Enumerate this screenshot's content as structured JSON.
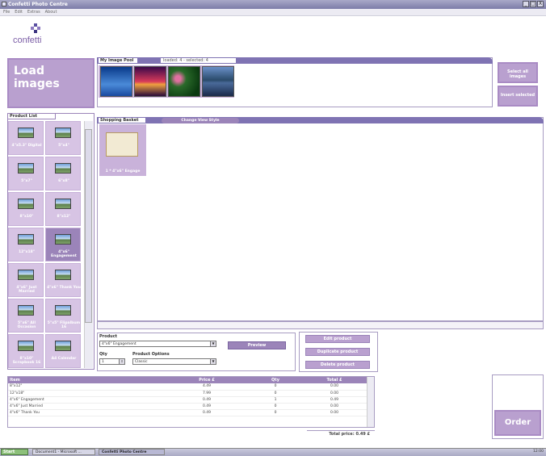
{
  "window": {
    "title": "Confetti Photo Centre",
    "menu": [
      "File",
      "Edit",
      "Extras",
      "About"
    ],
    "controls": [
      "_",
      "□",
      "X"
    ]
  },
  "logo": {
    "text": "confetti"
  },
  "load_images": {
    "label": "Load images"
  },
  "image_pool": {
    "tab": "My Image Pool",
    "status": "loaded: 4 - selected: 4",
    "thumbs": [
      "blue",
      "sunset",
      "flowers",
      "lake"
    ]
  },
  "pool_buttons": {
    "select_all": "Select all images",
    "insert_selected": "Insert selected"
  },
  "product_list": {
    "tab": "Product List",
    "items": [
      {
        "label": "4\"x5.3\" Digital"
      },
      {
        "label": "5\"x4\""
      },
      {
        "label": "5\"x7\""
      },
      {
        "label": "6\"x8\""
      },
      {
        "label": "8\"x10\""
      },
      {
        "label": "8\"x12\""
      },
      {
        "label": "12\"x18\""
      },
      {
        "label": "4\"x6\" Engagement"
      },
      {
        "label": "4\"x6\" Just Married"
      },
      {
        "label": "4\"x6\" Thank You"
      },
      {
        "label": "5\"x6\" All Occasion"
      },
      {
        "label": "5\"x5\" Flipalbum 16"
      },
      {
        "label": "8\"x10\" Scrapbook 16"
      },
      {
        "label": "A4 Calendar"
      }
    ]
  },
  "basket": {
    "tab": "Shopping Basket",
    "change_view": "Change View Style",
    "item_label": "1 * 4\"x6\" Engage"
  },
  "form": {
    "product_label": "Product",
    "product_value": "4\"x6\" Engagement",
    "qty_label": "Qty",
    "qty_value": "1",
    "options_label": "Product Options",
    "options_value": "Classic",
    "preview": "Preview"
  },
  "actions": {
    "edit": "Edit product",
    "duplicate": "Duplicate product",
    "delete": "Delete product"
  },
  "table": {
    "headers": [
      "Item",
      "Price £",
      "Qty",
      "Total £"
    ],
    "rows": [
      {
        "item": "8\"x12\"",
        "price": "4.49",
        "qty": "0",
        "total": "0.00"
      },
      {
        "item": "12\"x18\"",
        "price": "7.99",
        "qty": "0",
        "total": "0.00"
      },
      {
        "item": "4\"x6\" Engagement",
        "price": "0.49",
        "qty": "1",
        "total": "0.49"
      },
      {
        "item": "4\"x6\" Just Married",
        "price": "0.49",
        "qty": "0",
        "total": "0.00"
      },
      {
        "item": "4\"x6\" Thank You",
        "price": "0.49",
        "qty": "0",
        "total": "0.00"
      }
    ],
    "total": "Total price: 0.49 £"
  },
  "order": {
    "label": "Order"
  },
  "taskbar": {
    "start": "Start",
    "tasks": [
      "Document1 - Microsoft ...",
      "Confetti Photo Centre"
    ],
    "clock": "12:00"
  },
  "colors": {
    "accent": "#b9a0cf",
    "header": "#7f73b3"
  }
}
